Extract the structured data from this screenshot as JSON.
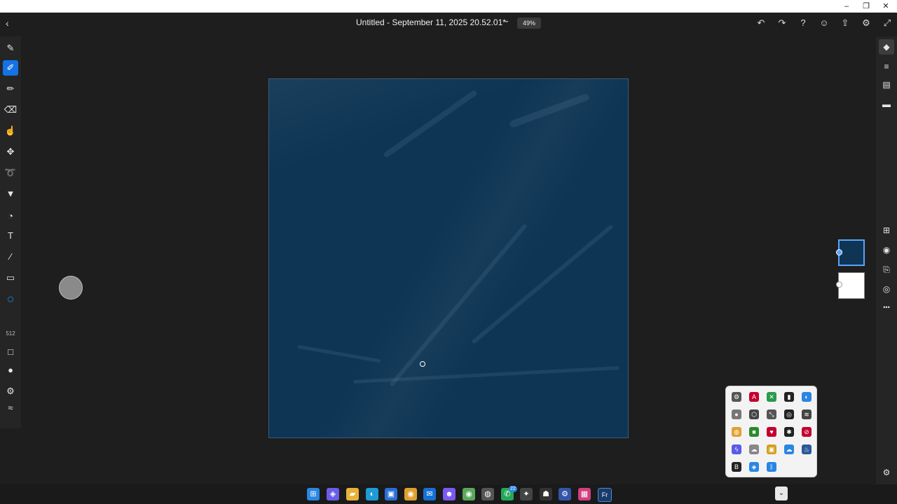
{
  "window": {
    "minimize_glyph": "–",
    "restore_glyph": "❐",
    "close_glyph": "✕"
  },
  "header": {
    "back_glyph": "‹",
    "title": "Untitled - September 11, 2025 20.52.01*",
    "title_chevron": "⌄",
    "zoom": "49%",
    "icons": [
      "undo-icon",
      "redo-icon",
      "help-icon",
      "account-icon",
      "share-icon",
      "settings-icon",
      "fullscreen-icon"
    ],
    "icon_glyphs": [
      "↶",
      "↷",
      "?",
      "☺",
      "⇪",
      "⚙",
      "⤢"
    ]
  },
  "left_tools": [
    {
      "name": "pixel-brush-icon",
      "glyph": "✎"
    },
    {
      "name": "vector-brush-icon",
      "glyph": "✐",
      "active": true
    },
    {
      "name": "live-brush-icon",
      "glyph": "✏"
    },
    {
      "name": "eraser-icon",
      "glyph": "⌫"
    },
    {
      "name": "smudge-icon",
      "glyph": "☝"
    },
    {
      "name": "move-icon",
      "glyph": "✥"
    },
    {
      "name": "lasso-icon",
      "glyph": "➰"
    },
    {
      "name": "fill-icon",
      "glyph": "▼"
    },
    {
      "name": "shape-icon",
      "glyph": "◔"
    },
    {
      "name": "text-icon",
      "glyph": "T"
    },
    {
      "name": "eyedropper-icon",
      "glyph": "⁄"
    },
    {
      "name": "image-icon",
      "glyph": "▭"
    },
    {
      "name": "color-circle-icon",
      "glyph": "○"
    },
    {
      "name": "brush-size-icon",
      "glyph": "512"
    },
    {
      "name": "square-brush-icon",
      "glyph": "□"
    },
    {
      "name": "flow-icon",
      "glyph": "●"
    },
    {
      "name": "brush-settings-icon",
      "glyph": "⚙"
    },
    {
      "name": "stroke-icon",
      "glyph": "≈"
    }
  ],
  "right_tools": [
    {
      "name": "layers-icon",
      "glyph": "◆",
      "active": true
    },
    {
      "name": "properties-icon",
      "glyph": "≡"
    },
    {
      "name": "library-icon",
      "glyph": "▤"
    },
    {
      "name": "comments-icon",
      "glyph": "▬"
    },
    {
      "name": "add-layer-icon",
      "glyph": "⊞"
    },
    {
      "name": "visibility-icon",
      "glyph": "◉"
    },
    {
      "name": "layer-menu-icon",
      "glyph": "⎘"
    },
    {
      "name": "blend-icon",
      "glyph": "◎"
    },
    {
      "name": "more-icon",
      "glyph": "•••"
    },
    {
      "name": "layer-settings-icon",
      "glyph": "⚙"
    },
    {
      "name": "edit-icon",
      "glyph": "✎"
    }
  ],
  "colors": {
    "artboard": "#0e3554",
    "accent": "#1473e6",
    "background": "#1e1e1e"
  },
  "taskbar": {
    "icons": [
      {
        "name": "start-icon",
        "glyph": "⊞",
        "color": "#2a86e3"
      },
      {
        "name": "copilot-icon",
        "glyph": "◈",
        "color": "#6a5de8"
      },
      {
        "name": "file-explorer-icon",
        "glyph": "▰",
        "color": "#e8b23a"
      },
      {
        "name": "edge-icon",
        "glyph": "◐",
        "color": "#1e9ad6"
      },
      {
        "name": "store-icon",
        "glyph": "▣",
        "color": "#2a6fd6"
      },
      {
        "name": "chrome-icon",
        "glyph": "◉",
        "color": "#e0a030"
      },
      {
        "name": "outlook-icon",
        "glyph": "✉",
        "color": "#1670d6"
      },
      {
        "name": "discord-icon",
        "glyph": "☻",
        "color": "#7a5af0"
      },
      {
        "name": "chrome-alt-icon",
        "glyph": "◉",
        "color": "#5aa85a"
      },
      {
        "name": "app-icon",
        "glyph": "◍",
        "color": "#555555"
      },
      {
        "name": "whatsapp-icon",
        "glyph": "✆",
        "color": "#25a85a"
      },
      {
        "name": "app2-icon",
        "glyph": "✦",
        "color": "#444444"
      },
      {
        "name": "app3-icon",
        "glyph": "☗",
        "color": "#333333"
      },
      {
        "name": "app4-icon",
        "glyph": "⚙",
        "color": "#3355aa"
      },
      {
        "name": "app5-icon",
        "glyph": "▦",
        "color": "#d04080"
      },
      {
        "name": "fresco-icon",
        "glyph": "Fr",
        "color": "#1a3a6a"
      }
    ],
    "whatsapp_badge": "22",
    "tray_chevron": "⌄"
  },
  "tray_popup": {
    "items": [
      "⚙",
      "A",
      "✕",
      "▮",
      "◐",
      "●",
      "⬡",
      "⤡",
      "◎",
      "≋",
      "◍",
      "■",
      "♥",
      "✱",
      "⊘",
      "ϟ",
      "☁",
      "▣",
      "☁",
      "♨",
      "B",
      "◈",
      "ᛒ"
    ],
    "colors": [
      "#555",
      "#c3002f",
      "#2a9a4a",
      "#222",
      "#2a86e3",
      "#777",
      "#444",
      "#555",
      "#222",
      "#444",
      "#e0a030",
      "#2a8a2a",
      "#c3002f",
      "#222",
      "#c3002f",
      "#5a5ae8",
      "#888",
      "#d4a020",
      "#2a86e3",
      "#2a5a9a",
      "#222",
      "#2a86e3",
      "#2a86e3"
    ]
  }
}
